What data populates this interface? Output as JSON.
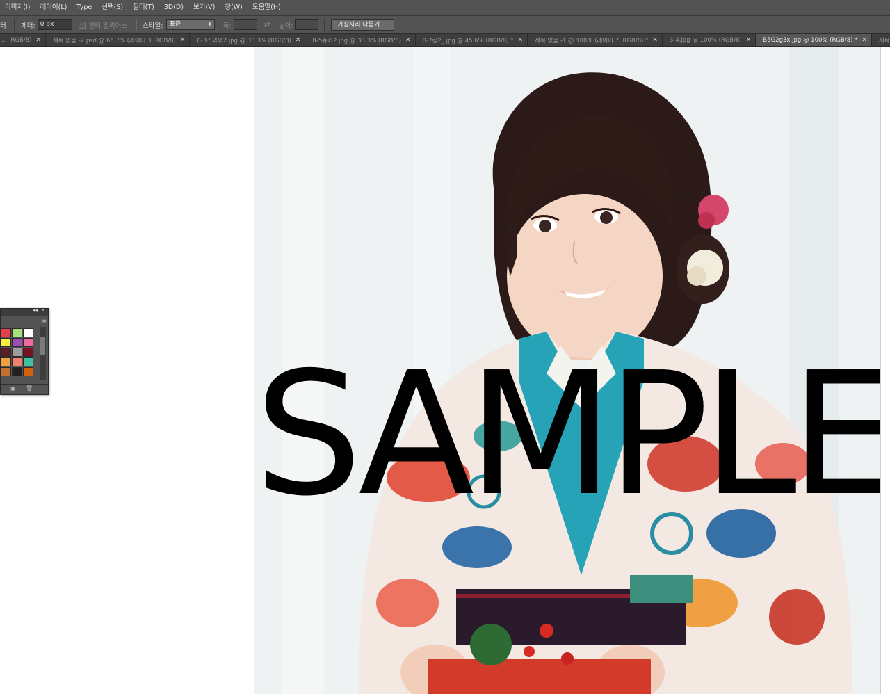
{
  "menu": {
    "items": [
      "이미지(I)",
      "레이어(L)",
      "Type",
      "선택(S)",
      "필터(T)",
      "3D(D)",
      "보기(V)",
      "창(W)",
      "도움말(H)"
    ]
  },
  "options": {
    "tool_glyph": "터",
    "feather_label": "페더:",
    "feather_value": "0 px",
    "antialias_label": "앤티 앨리어스",
    "style_label": "스타일:",
    "style_value": "표준",
    "width_label": "폭:",
    "height_label": "높이:",
    "refine_edge_label": "가장자리 다듬기 ..."
  },
  "tabs": [
    {
      "label": "..., RGB/8)",
      "active": false
    },
    {
      "label": "제목 없음 -2.psd @ 66.7% (레이어 3, RGB/8)",
      "active": false
    },
    {
      "label": "0-3스와와2.jpg @ 33.3% (RGB/8)",
      "active": false
    },
    {
      "label": "0-5슈카2.jpg @ 33.3% (RGB/8)",
      "active": false
    },
    {
      "label": "0-7킹2_.jpg @ 45.6% (RGB/8) *",
      "active": false
    },
    {
      "label": "제목 없음 -1 @ 100% (레이어 7, RGB/8) *",
      "active": false
    },
    {
      "label": "3-4.jpg @ 100% (RGB/8)",
      "active": false
    },
    {
      "label": "B5G2g3x.jpg @ 100% (RGB/8) *",
      "active": true
    },
    {
      "label": "제목 없음",
      "active": false
    }
  ],
  "canvas": {
    "watermark_text": "SAMPLE"
  },
  "swatches": {
    "colors": [
      "#e8404a",
      "#a5e07a",
      "#ffffff",
      "#f6f03a",
      "#9a4fb0",
      "#f06aa0",
      "#5a1e2a",
      "#9c9c9c",
      "#7a1020",
      "#f0a040",
      "#f08070",
      "#40c0a0",
      "#c07030",
      "#202020",
      "#d06010"
    ]
  }
}
